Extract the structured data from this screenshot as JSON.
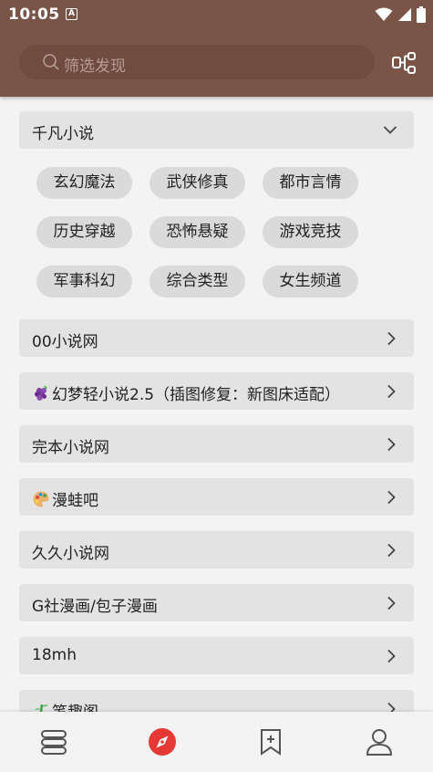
{
  "status_bar": {
    "time": "10:05",
    "notification_badge": "A"
  },
  "search": {
    "placeholder": "筛选发现"
  },
  "group": {
    "title": "千凡小说",
    "tags": [
      "玄幻魔法",
      "武侠修真",
      "都市言情",
      "历史穿越",
      "恐怖悬疑",
      "游戏竞技",
      "军事科幻",
      "综合类型",
      "女生频道"
    ]
  },
  "sources": [
    {
      "label": "00小说网"
    },
    {
      "label": "幻梦轻小说2.5（插图修复：新图床适配）",
      "emoji": "grapes"
    },
    {
      "label": "完本小说网"
    },
    {
      "label": "漫蛙吧",
      "emoji": "palette"
    },
    {
      "label": "久久小说网"
    },
    {
      "label": "G社漫画/包子漫画"
    },
    {
      "label": "18mh"
    },
    {
      "label": "笔趣阁",
      "emoji": "bamboo"
    }
  ],
  "bottom_nav": [
    "bookshelf-icon",
    "discover-icon",
    "bookmark-add-icon",
    "profile-icon"
  ],
  "colors": {
    "header": "#7a5447",
    "accent": "#e53935",
    "row_bg": "#e3e3e3",
    "tag_bg": "#dadada"
  }
}
